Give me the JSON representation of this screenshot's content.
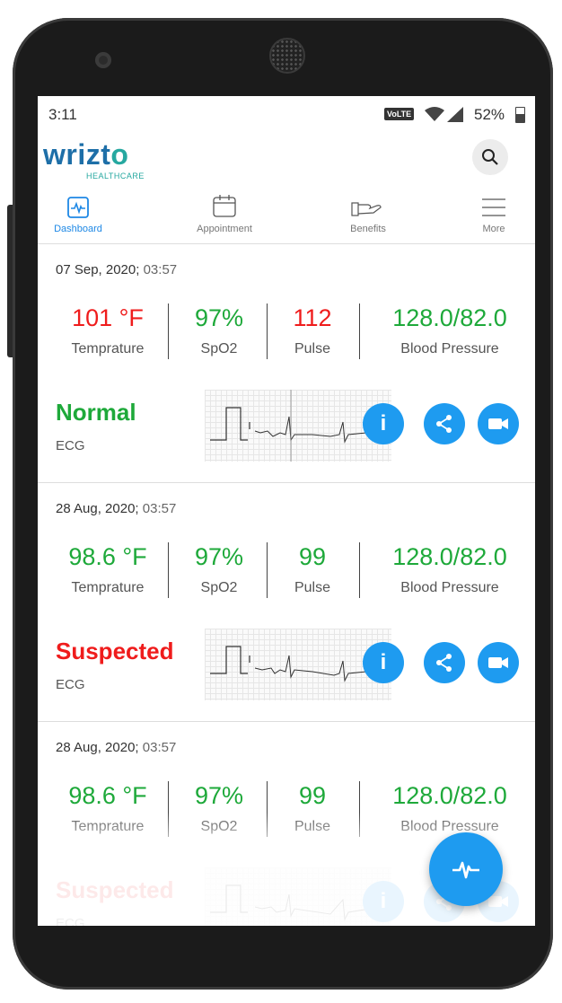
{
  "status": {
    "time": "3:11",
    "network": "VoLTE",
    "battery": "52%"
  },
  "app": {
    "logo_main_part1": "wrizt",
    "logo_main_part2": "o",
    "logo_sub": "HEALTHCARE"
  },
  "nav": {
    "items": [
      {
        "label": "Dashboard",
        "icon": "heartbeat-icon",
        "active": true
      },
      {
        "label": "Appointment",
        "icon": "calendar-icon"
      },
      {
        "label": "Benefits",
        "icon": "hand-icon"
      },
      {
        "label": "More",
        "icon": "menu-icon"
      }
    ]
  },
  "records": [
    {
      "date": "07 Sep, 2020;",
      "time": "03:57",
      "temperature": {
        "value": "101 °F",
        "label": "Temprature",
        "status": "red"
      },
      "spo2": {
        "value": "97%",
        "label": "SpO2",
        "status": "green"
      },
      "pulse": {
        "value": "112",
        "label": "Pulse",
        "status": "red"
      },
      "bp": {
        "value": "128.0/82.0",
        "label": "Blood Pressure",
        "status": "green"
      },
      "ecg": {
        "status": "Normal",
        "label": "ECG",
        "status_color": "green"
      }
    },
    {
      "date": "28 Aug, 2020;",
      "time": "03:57",
      "temperature": {
        "value": "98.6 °F",
        "label": "Temprature",
        "status": "green"
      },
      "spo2": {
        "value": "97%",
        "label": "SpO2",
        "status": "green"
      },
      "pulse": {
        "value": "99",
        "label": "Pulse",
        "status": "green"
      },
      "bp": {
        "value": "128.0/82.0",
        "label": "Blood Pressure",
        "status": "green"
      },
      "ecg": {
        "status": "Suspected",
        "label": "ECG",
        "status_color": "red"
      }
    },
    {
      "date": "28 Aug, 2020;",
      "time": "03:57",
      "temperature": {
        "value": "98.6 °F",
        "label": "Temprature",
        "status": "green"
      },
      "spo2": {
        "value": "97%",
        "label": "SpO2",
        "status": "green"
      },
      "pulse": {
        "value": "99",
        "label": "Pulse",
        "status": "green"
      },
      "bp": {
        "value": "128.0/82.0",
        "label": "Blood Pressure",
        "status": "green"
      },
      "ecg": {
        "status": "Suspected",
        "label": "ECG",
        "status_color": "red"
      }
    }
  ],
  "actions": {
    "info_label": "i"
  },
  "colors": {
    "accent": "#1e9bf0",
    "alert": "#ef1c1c",
    "ok": "#1ea93a"
  }
}
